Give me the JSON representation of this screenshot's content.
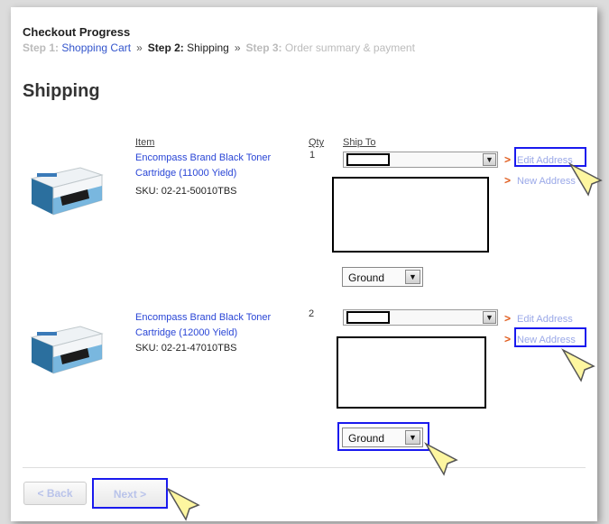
{
  "checkout": {
    "title": "Checkout Progress",
    "step1_prefix": "Step 1:",
    "step1_label": "Shopping Cart",
    "step2_prefix": "Step 2:",
    "step2_label": "Shipping",
    "step3_prefix": "Step 3:",
    "step3_label": "Order summary & payment",
    "separator": "»"
  },
  "page_title": "Shipping",
  "columns": {
    "item": "Item",
    "qty": "Qty",
    "ship_to": "Ship To"
  },
  "items": [
    {
      "name": "Encompass Brand Black Toner Cartridge (11000 Yield)",
      "sku": "SKU: 02-21-50010TBS",
      "qty": "1",
      "edit_address": "Edit Address",
      "new_address": "New Address",
      "shipping_method": "Ground"
    },
    {
      "name": "Encompass Brand Black Toner Cartridge (12000 Yield)",
      "sku": "SKU: 02-21-47010TBS",
      "qty": "2",
      "edit_address": "Edit Address",
      "new_address": "New Address",
      "shipping_method": "Ground"
    }
  ],
  "buttons": {
    "back": "< Back",
    "next": "Next >"
  },
  "icons": {
    "dropdown": "chevron-down-icon",
    "pointer": "callout-pointer-icon"
  },
  "colors": {
    "link": "#2a46d6",
    "highlight": "#1a1aee",
    "arrow": "#e05a1a",
    "pointer": "#fdf6a0"
  }
}
